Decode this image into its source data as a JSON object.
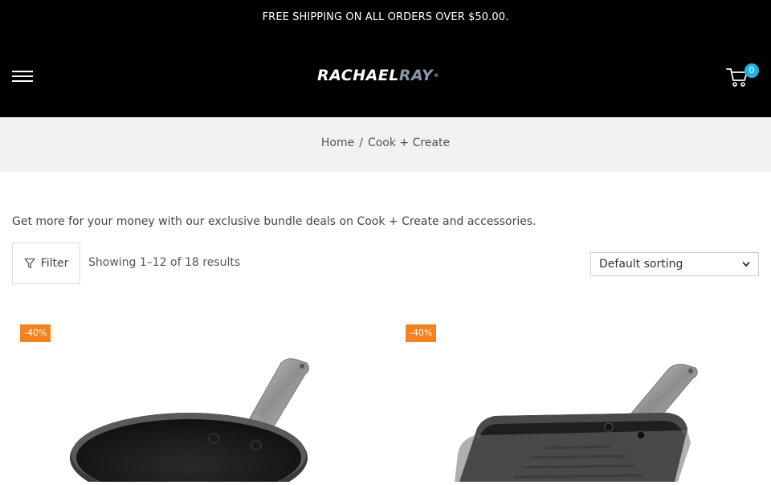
{
  "announcement": "FREE SHIPPING ON ALL ORDERS OVER $50.00.",
  "brand": {
    "part1": "RACHAEL",
    "part2": "RAY",
    "tm": "®"
  },
  "cart": {
    "count": "0"
  },
  "breadcrumb": {
    "home": "Home",
    "separator": "/",
    "current": "Cook + Create"
  },
  "intro_text": "Get more for your money with our exclusive bundle deals on Cook + Create and accessories.",
  "toolbar": {
    "filter_label": "Filter",
    "results_text": "Showing 1–12 of 18 results",
    "sort_selected": "Default sorting"
  },
  "products": [
    {
      "discount": "-40%",
      "image": "skillet-pan"
    },
    {
      "discount": "-40%",
      "image": "grill-pan"
    }
  ],
  "colors": {
    "header_bg": "#000000",
    "badge": "#f58220",
    "cart_badge": "#1fb5e3",
    "crumb_bg": "#f2f2f2"
  }
}
